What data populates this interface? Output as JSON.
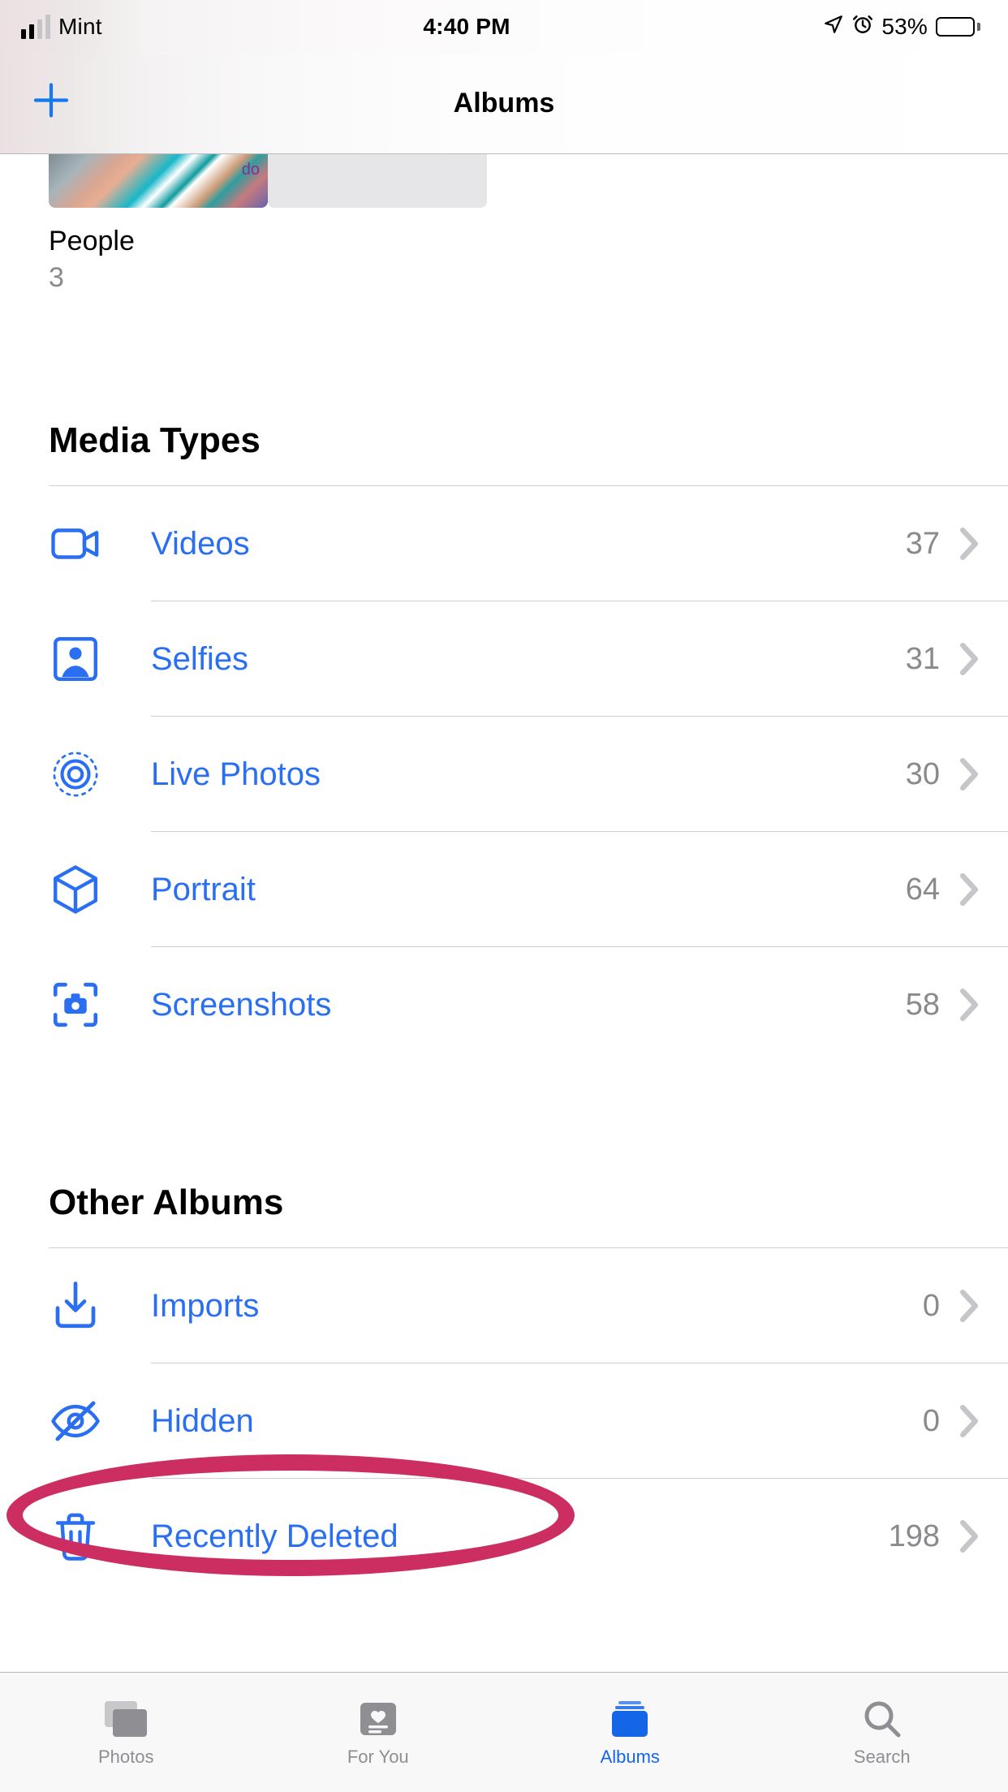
{
  "status": {
    "carrier": "Mint",
    "time": "4:40 PM",
    "battery_pct": "53%"
  },
  "nav": {
    "title": "Albums"
  },
  "people_album": {
    "label": "People",
    "count": "3"
  },
  "sections": {
    "media_types_title": "Media Types",
    "other_albums_title": "Other Albums"
  },
  "media_types": [
    {
      "id": "videos",
      "icon": "video-icon",
      "label": "Videos",
      "count": "37"
    },
    {
      "id": "selfies",
      "icon": "selfie-icon",
      "label": "Selfies",
      "count": "31"
    },
    {
      "id": "livephotos",
      "icon": "live-photos-icon",
      "label": "Live Photos",
      "count": "30"
    },
    {
      "id": "portrait",
      "icon": "portrait-icon",
      "label": "Portrait",
      "count": "64"
    },
    {
      "id": "screenshots",
      "icon": "screenshot-icon",
      "label": "Screenshots",
      "count": "58"
    }
  ],
  "other_albums": [
    {
      "id": "imports",
      "icon": "import-icon",
      "label": "Imports",
      "count": "0"
    },
    {
      "id": "hidden",
      "icon": "hidden-icon",
      "label": "Hidden",
      "count": "0"
    },
    {
      "id": "recently",
      "icon": "trash-icon",
      "label": "Recently Deleted",
      "count": "198"
    }
  ],
  "tabs": {
    "photos": "Photos",
    "foryou": "For You",
    "albums": "Albums",
    "search": "Search"
  },
  "colors": {
    "tint": "#2a6ff2",
    "annotation": "#cc2e62",
    "secondary_text": "#8a8a8e"
  }
}
